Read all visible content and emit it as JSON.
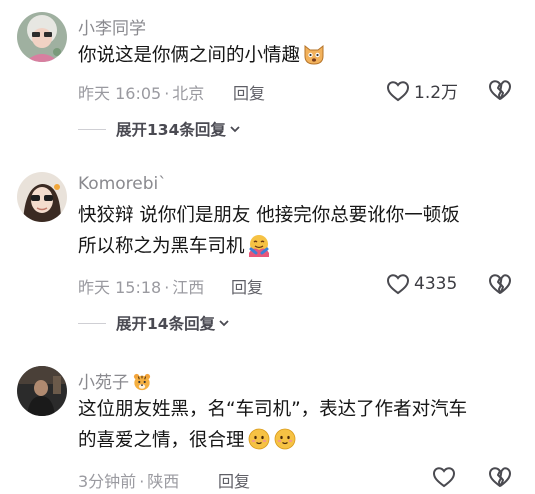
{
  "comments": [
    {
      "username": "小李同学",
      "text_lines": [
        "你说这是你俩之间的小情趣"
      ],
      "emoji": "cat-face-emoji",
      "time": "昨天 16:05",
      "location": "北京",
      "reply_label": "回复",
      "likes": "1.2万",
      "expand_label": "展开134条回复"
    },
    {
      "username": "Komorebi`",
      "text_lines": [
        "快狡辩 说你们是朋友 他接完你总要讹你一顿饭",
        "所以称之为黑车司机"
      ],
      "emoji": "hug-emoji",
      "time": "昨天 15:18",
      "location": "江西",
      "reply_label": "回复",
      "likes": "4335",
      "expand_label": "展开14条回复"
    },
    {
      "username": "小苑子",
      "user_badge": "tiger-emoji",
      "text_lines": [
        "这位朋友姓黑，名“车司机”，表达了作者对汽车",
        "的喜爱之情，很合理"
      ],
      "emoji": "smile-emoji",
      "time": "3分钟前",
      "location": "陕西",
      "reply_label": "回复",
      "likes": ""
    }
  ],
  "colors": {
    "text": "#161616",
    "muted": "#9a9aa0",
    "username": "#8a8a8f"
  }
}
